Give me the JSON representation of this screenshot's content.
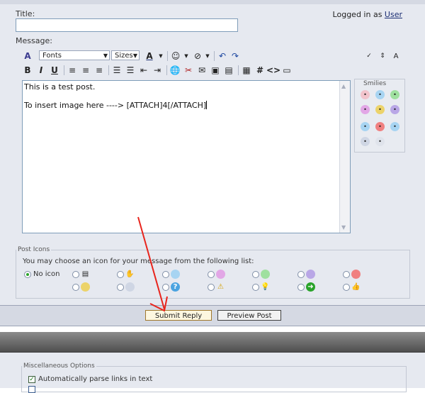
{
  "form": {
    "title_label": "Title:",
    "title_value": "",
    "logged_in_prefix": "Logged in as",
    "logged_in_user": "User",
    "message_label": "Message:"
  },
  "toolbar": {
    "font_select": "Fonts",
    "size_select": "Sizes",
    "bold": "B",
    "italic": "I",
    "underline": "U"
  },
  "editor": {
    "line1": "This is a test post.",
    "line2": "To insert image here ----> [ATTACH]4[/ATTACH]"
  },
  "smilies": {
    "header": "Smilies"
  },
  "post_icons": {
    "legend": "Post Icons",
    "instructions": "You may choose an icon for your message from the following list:",
    "no_icon_label": "No icon"
  },
  "buttons": {
    "submit": "Submit Reply",
    "preview": "Preview Post"
  },
  "misc": {
    "legend": "Miscellaneous Options",
    "parse_links": "Automatically parse links in text"
  },
  "annotation_color": "#e8241c"
}
